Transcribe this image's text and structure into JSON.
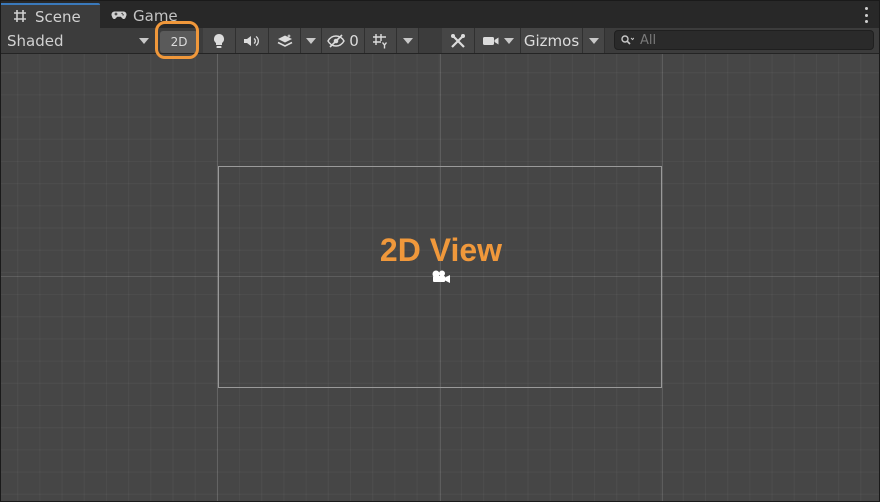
{
  "tabs": [
    {
      "label": "Scene",
      "icon": "grid-hash-icon",
      "active": true
    },
    {
      "label": "Game",
      "icon": "gamepad-icon",
      "active": false
    }
  ],
  "toolbar": {
    "shading_mode": "Shaded",
    "mode_2d_label": "2D",
    "hidden_count": "0",
    "gizmos_label": "Gizmos"
  },
  "search": {
    "placeholder": "All"
  },
  "scene": {
    "overlay_label": "2D View"
  },
  "colors": {
    "highlight": "#f0983b",
    "tab_accent": "#3a79bb",
    "scene_bg": "#464646"
  }
}
